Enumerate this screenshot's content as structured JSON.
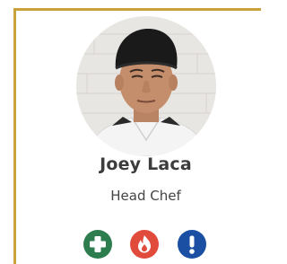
{
  "profile": {
    "name": "Joey Laca",
    "role": "Head Chef"
  },
  "accent_color": "#c9a23c",
  "actions": [
    {
      "icon": "plus-icon",
      "color": "#2e7d4f"
    },
    {
      "icon": "flame-icon",
      "color": "#e04b3c"
    },
    {
      "icon": "exclamation-icon",
      "color": "#1a4fa3"
    }
  ]
}
